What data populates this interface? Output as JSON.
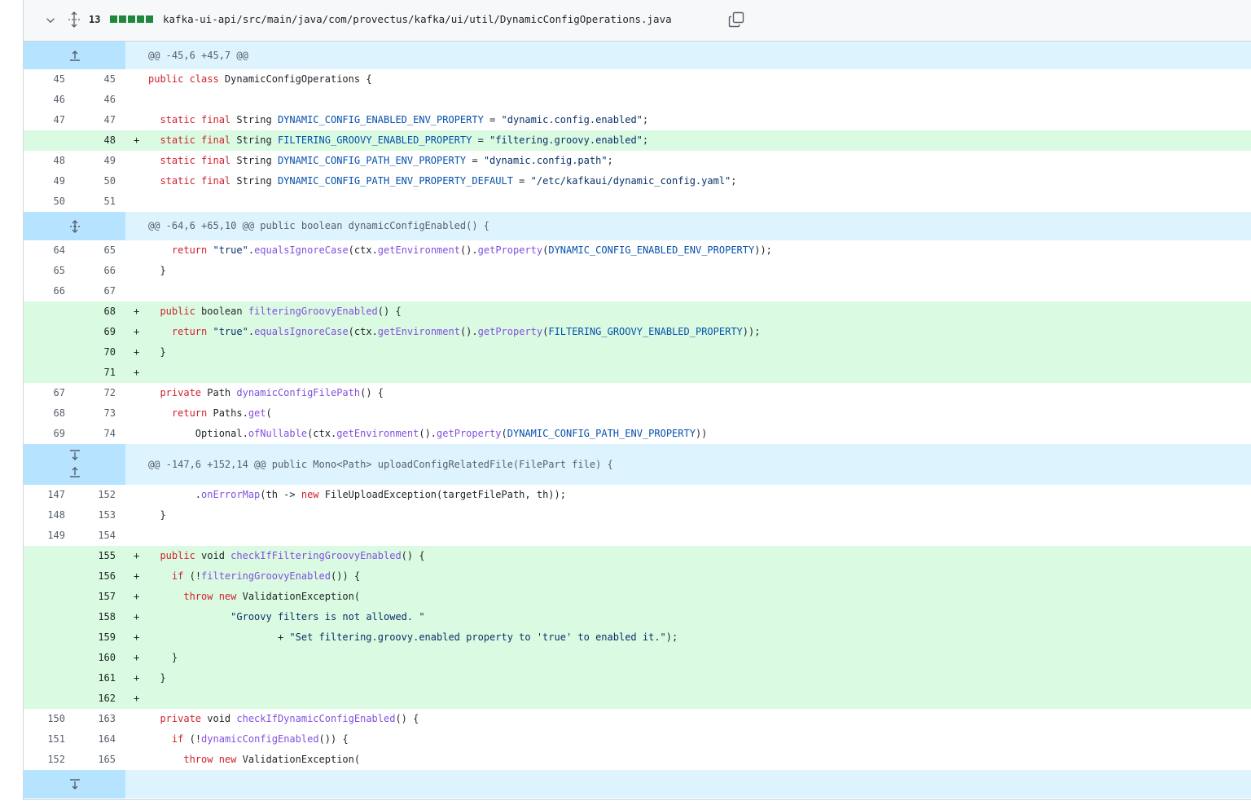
{
  "file_header": {
    "changes_count": "13",
    "path": "kafka-ui-api/src/main/java/com/provectus/kafka/ui/util/DynamicConfigOperations.java",
    "icons": [
      "chevron-down-icon",
      "unfold-icon",
      "copy-icon"
    ],
    "diffstat_color": "#1f883d"
  },
  "colors": {
    "addition_bg": "#dafbe1",
    "hunk_bg": "#ddf4ff",
    "hunk_gutter_bg": "#b6e3ff",
    "keyword": "#cf222e",
    "function": "#8250df",
    "constant": "#0550ae",
    "string": "#0a3069"
  },
  "rows": [
    {
      "type": "hunk",
      "expand": "up",
      "text": "@@ -45,6 +45,7 @@"
    },
    {
      "type": "ctx",
      "old": "45",
      "new": "45",
      "tokens": [
        [
          "kw",
          "public class "
        ],
        [
          "",
          "DynamicConfigOperations {"
        ]
      ]
    },
    {
      "type": "ctx",
      "old": "46",
      "new": "46",
      "tokens": []
    },
    {
      "type": "ctx",
      "old": "47",
      "new": "47",
      "tokens": [
        [
          "",
          "  "
        ],
        [
          "kw",
          "static final "
        ],
        [
          "",
          "String "
        ],
        [
          "cst",
          "DYNAMIC_CONFIG_ENABLED_ENV_PROPERTY"
        ],
        [
          "",
          " = "
        ],
        [
          "str",
          "\"dynamic.config.enabled\""
        ],
        [
          "",
          ";"
        ]
      ]
    },
    {
      "type": "add",
      "old": "",
      "new": "48",
      "tokens": [
        [
          "",
          "  "
        ],
        [
          "kw",
          "static final "
        ],
        [
          "",
          "String "
        ],
        [
          "cst",
          "FILTERING_GROOVY_ENABLED_PROPERTY"
        ],
        [
          "",
          " = "
        ],
        [
          "str",
          "\"filtering.groovy.enabled\""
        ],
        [
          "",
          ";"
        ]
      ]
    },
    {
      "type": "ctx",
      "old": "48",
      "new": "49",
      "tokens": [
        [
          "",
          "  "
        ],
        [
          "kw",
          "static final "
        ],
        [
          "",
          "String "
        ],
        [
          "cst",
          "DYNAMIC_CONFIG_PATH_ENV_PROPERTY"
        ],
        [
          "",
          " = "
        ],
        [
          "str",
          "\"dynamic.config.path\""
        ],
        [
          "",
          ";"
        ]
      ]
    },
    {
      "type": "ctx",
      "old": "49",
      "new": "50",
      "tokens": [
        [
          "",
          "  "
        ],
        [
          "kw",
          "static final "
        ],
        [
          "",
          "String "
        ],
        [
          "cst",
          "DYNAMIC_CONFIG_PATH_ENV_PROPERTY_DEFAULT"
        ],
        [
          "",
          " = "
        ],
        [
          "str",
          "\"/etc/kafkaui/dynamic_config.yaml\""
        ],
        [
          "",
          ";"
        ]
      ]
    },
    {
      "type": "ctx",
      "old": "50",
      "new": "51",
      "tokens": []
    },
    {
      "type": "hunk",
      "expand": "both",
      "text": "@@ -64,6 +65,10 @@ public boolean dynamicConfigEnabled() {"
    },
    {
      "type": "ctx",
      "old": "64",
      "new": "65",
      "tokens": [
        [
          "",
          "    "
        ],
        [
          "kw",
          "return "
        ],
        [
          "str",
          "\"true\""
        ],
        [
          "",
          "."
        ],
        [
          "fn",
          "equalsIgnoreCase"
        ],
        [
          "",
          "(ctx."
        ],
        [
          "fn",
          "getEnvironment"
        ],
        [
          "",
          "()."
        ],
        [
          "fn",
          "getProperty"
        ],
        [
          "",
          "("
        ],
        [
          "cst",
          "DYNAMIC_CONFIG_ENABLED_ENV_PROPERTY"
        ],
        [
          "",
          "));"
        ]
      ]
    },
    {
      "type": "ctx",
      "old": "65",
      "new": "66",
      "tokens": [
        [
          "",
          "  }"
        ]
      ]
    },
    {
      "type": "ctx",
      "old": "66",
      "new": "67",
      "tokens": []
    },
    {
      "type": "add",
      "old": "",
      "new": "68",
      "tokens": [
        [
          "",
          "  "
        ],
        [
          "kw",
          "public "
        ],
        [
          "",
          "boolean "
        ],
        [
          "fn",
          "filteringGroovyEnabled"
        ],
        [
          "",
          "() {"
        ]
      ]
    },
    {
      "type": "add",
      "old": "",
      "new": "69",
      "tokens": [
        [
          "",
          "    "
        ],
        [
          "kw",
          "return "
        ],
        [
          "str",
          "\"true\""
        ],
        [
          "",
          "."
        ],
        [
          "fn",
          "equalsIgnoreCase"
        ],
        [
          "",
          "(ctx."
        ],
        [
          "fn",
          "getEnvironment"
        ],
        [
          "",
          "()."
        ],
        [
          "fn",
          "getProperty"
        ],
        [
          "",
          "("
        ],
        [
          "cst",
          "FILTERING_GROOVY_ENABLED_PROPERTY"
        ],
        [
          "",
          "));"
        ]
      ]
    },
    {
      "type": "add",
      "old": "",
      "new": "70",
      "tokens": [
        [
          "",
          "  }"
        ]
      ]
    },
    {
      "type": "add",
      "old": "",
      "new": "71",
      "tokens": []
    },
    {
      "type": "ctx",
      "old": "67",
      "new": "72",
      "tokens": [
        [
          "",
          "  "
        ],
        [
          "kw",
          "private "
        ],
        [
          "",
          "Path "
        ],
        [
          "fn",
          "dynamicConfigFilePath"
        ],
        [
          "",
          "() {"
        ]
      ]
    },
    {
      "type": "ctx",
      "old": "68",
      "new": "73",
      "tokens": [
        [
          "",
          "    "
        ],
        [
          "kw",
          "return "
        ],
        [
          "",
          "Paths."
        ],
        [
          "fn",
          "get"
        ],
        [
          "",
          "("
        ]
      ]
    },
    {
      "type": "ctx",
      "old": "69",
      "new": "74",
      "tokens": [
        [
          "",
          "        Optional."
        ],
        [
          "fn",
          "ofNullable"
        ],
        [
          "",
          "(ctx."
        ],
        [
          "fn",
          "getEnvironment"
        ],
        [
          "",
          "()."
        ],
        [
          "fn",
          "getProperty"
        ],
        [
          "",
          "("
        ],
        [
          "cst",
          "DYNAMIC_CONFIG_PATH_ENV_PROPERTY"
        ],
        [
          "",
          "))"
        ]
      ]
    },
    {
      "type": "hunk",
      "expand": "split",
      "text": "@@ -147,6 +152,14 @@ public Mono<Path> uploadConfigRelatedFile(FilePart file) {"
    },
    {
      "type": "ctx",
      "old": "147",
      "new": "152",
      "tokens": [
        [
          "",
          "        ."
        ],
        [
          "fn",
          "onErrorMap"
        ],
        [
          "",
          "(th -> "
        ],
        [
          "kw",
          "new "
        ],
        [
          "",
          "FileUploadException(targetFilePath, th));"
        ]
      ]
    },
    {
      "type": "ctx",
      "old": "148",
      "new": "153",
      "tokens": [
        [
          "",
          "  }"
        ]
      ]
    },
    {
      "type": "ctx",
      "old": "149",
      "new": "154",
      "tokens": []
    },
    {
      "type": "add",
      "old": "",
      "new": "155",
      "tokens": [
        [
          "",
          "  "
        ],
        [
          "kw",
          "public "
        ],
        [
          "",
          "void "
        ],
        [
          "fn",
          "checkIfFilteringGroovyEnabled"
        ],
        [
          "",
          "() {"
        ]
      ]
    },
    {
      "type": "add",
      "old": "",
      "new": "156",
      "tokens": [
        [
          "",
          "    "
        ],
        [
          "kw",
          "if "
        ],
        [
          "",
          "(!"
        ],
        [
          "fn",
          "filteringGroovyEnabled"
        ],
        [
          "",
          "()) {"
        ]
      ]
    },
    {
      "type": "add",
      "old": "",
      "new": "157",
      "tokens": [
        [
          "",
          "      "
        ],
        [
          "kw",
          "throw new "
        ],
        [
          "",
          "ValidationException("
        ]
      ]
    },
    {
      "type": "add",
      "old": "",
      "new": "158",
      "tokens": [
        [
          "",
          "              "
        ],
        [
          "str",
          "\"Groovy filters is not allowed. \""
        ]
      ]
    },
    {
      "type": "add",
      "old": "",
      "new": "159",
      "tokens": [
        [
          "",
          "                      + "
        ],
        [
          "str",
          "\"Set filtering.groovy.enabled property to 'true' to enabled it.\""
        ],
        [
          "",
          ");"
        ]
      ]
    },
    {
      "type": "add",
      "old": "",
      "new": "160",
      "tokens": [
        [
          "",
          "    }"
        ]
      ]
    },
    {
      "type": "add",
      "old": "",
      "new": "161",
      "tokens": [
        [
          "",
          "  }"
        ]
      ]
    },
    {
      "type": "add",
      "old": "",
      "new": "162",
      "tokens": []
    },
    {
      "type": "ctx",
      "old": "150",
      "new": "163",
      "tokens": [
        [
          "",
          "  "
        ],
        [
          "kw",
          "private "
        ],
        [
          "",
          "void "
        ],
        [
          "fn",
          "checkIfDynamicConfigEnabled"
        ],
        [
          "",
          "() {"
        ]
      ]
    },
    {
      "type": "ctx",
      "old": "151",
      "new": "164",
      "tokens": [
        [
          "",
          "    "
        ],
        [
          "kw",
          "if "
        ],
        [
          "",
          "(!"
        ],
        [
          "fn",
          "dynamicConfigEnabled"
        ],
        [
          "",
          "()) {"
        ]
      ]
    },
    {
      "type": "ctx",
      "old": "152",
      "new": "165",
      "tokens": [
        [
          "",
          "      "
        ],
        [
          "kw",
          "throw new "
        ],
        [
          "",
          "ValidationException("
        ]
      ]
    },
    {
      "type": "hunk",
      "expand": "down",
      "text": ""
    }
  ]
}
